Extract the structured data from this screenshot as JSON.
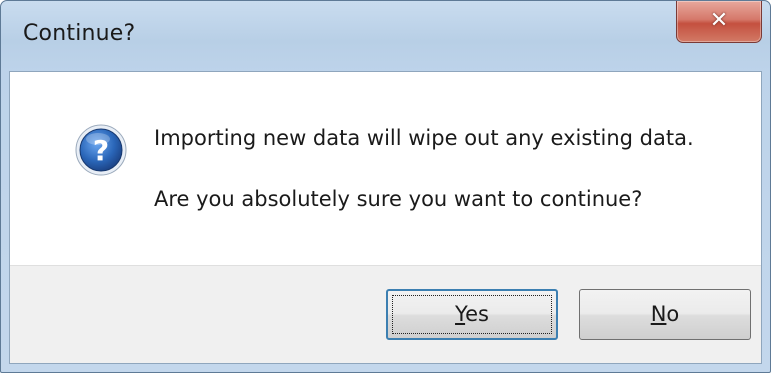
{
  "window": {
    "title": "Continue?"
  },
  "icons": {
    "close": "close-icon",
    "message": "question-icon"
  },
  "message": {
    "line1": "Importing new data will wipe out any existing data.",
    "line2": "Are you absolutely sure you want to continue?"
  },
  "buttons": {
    "yes": {
      "mnemonic": "Y",
      "rest": "es"
    },
    "no": {
      "mnemonic": "N",
      "rest": "o"
    }
  },
  "colors": {
    "close_button": "#c4503f",
    "question_icon": "#2a66b8",
    "focus_border": "#3c7fb1"
  }
}
